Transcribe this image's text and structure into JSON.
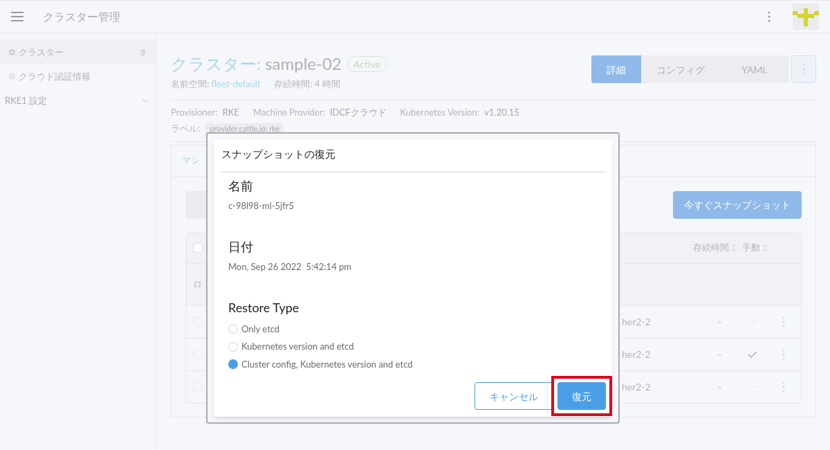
{
  "header": {
    "title": "クラスター管理"
  },
  "sidebar": {
    "items": [
      {
        "label": "クラスター",
        "count": "3",
        "selected": true,
        "kind": "globe"
      },
      {
        "label": "クラウド認証情報",
        "selected": false,
        "kind": "globe"
      }
    ],
    "group": {
      "label": "RKE1 設定",
      "expanded": false
    }
  },
  "page": {
    "title_prefix": "クラスター:",
    "title": "sample-02",
    "status": "Active",
    "meta": [
      {
        "label": "名前空間:",
        "value": "fleet-default",
        "kind": "link"
      },
      {
        "label": "存続時間:",
        "value": "4 時間",
        "kind": "text"
      }
    ],
    "view_tabs": [
      {
        "label": "詳細",
        "selected": true
      },
      {
        "label": "コンフィグ",
        "selected": false
      },
      {
        "label": "YAML",
        "selected": false
      }
    ],
    "details": [
      {
        "label": "Provisioner:",
        "value": "RKE"
      },
      {
        "label": "Machine Provider:",
        "value": "IDCFクラウド"
      },
      {
        "label": "Kubernetes Version:",
        "value": "v1.20.15"
      }
    ],
    "labels_label": "ラベル:",
    "label_tag": "provider.cattle.io: rke",
    "section_tab": "マシ",
    "snapshot_button": "今すぐスナップショット",
    "table": {
      "columns": [
        "存続時間",
        "手動"
      ],
      "all_checked": false,
      "group_label": "ロ",
      "rows": [
        {
          "name": "her2-2",
          "age": "-",
          "manual": false,
          "checked": false
        },
        {
          "name": "her2-2",
          "age": "-",
          "manual": true,
          "checked": false
        },
        {
          "name": "her2-2",
          "age": "-",
          "manual": false,
          "checked": false
        }
      ]
    }
  },
  "dialog": {
    "title": "スナップショットの復元",
    "fields": [
      {
        "label": "名前",
        "value": "c-98l98-ml-5jfr5"
      },
      {
        "label": "日付",
        "value": "Mon, Sep 26 2022  5:42:14 pm"
      }
    ],
    "restore_type": {
      "label": "Restore Type",
      "options": [
        {
          "label": "Only etcd",
          "selected": false
        },
        {
          "label": "Kubernetes version and etcd",
          "selected": false
        },
        {
          "label": "Cluster config, Kubernetes version and etcd",
          "selected": true
        }
      ]
    },
    "cancel": "キャンセル",
    "confirm": "復元",
    "confirm_highlighted": true
  }
}
